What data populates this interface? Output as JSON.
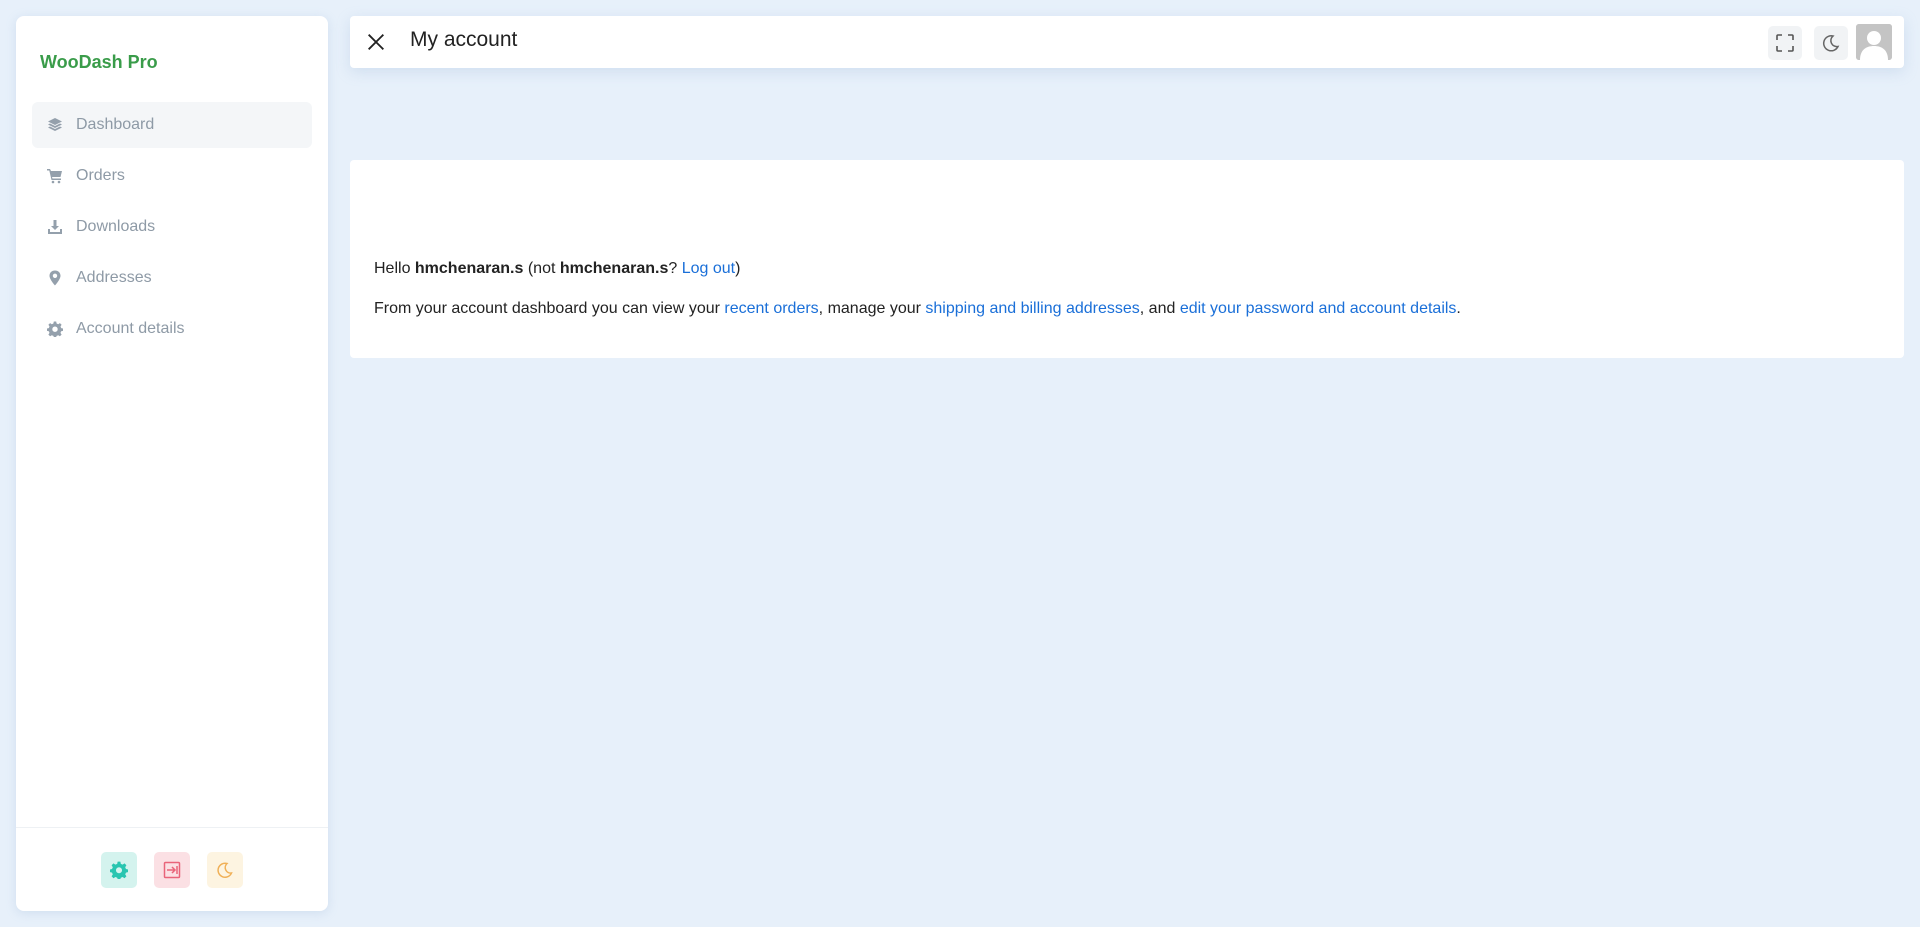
{
  "brand": "WooDash Pro",
  "sidebar": {
    "items": [
      {
        "label": "Dashboard",
        "icon": "layers-icon",
        "active": true
      },
      {
        "label": "Orders",
        "icon": "cart-icon"
      },
      {
        "label": "Downloads",
        "icon": "download-icon"
      },
      {
        "label": "Addresses",
        "icon": "map-pin-icon"
      },
      {
        "label": "Account details",
        "icon": "gear-icon"
      }
    ],
    "footer": [
      {
        "icon": "gear-icon",
        "color": "#29c5b0"
      },
      {
        "icon": "logout-icon",
        "color": "#e9647a"
      },
      {
        "icon": "moon-icon",
        "color": "#f0b057"
      }
    ]
  },
  "header": {
    "title": "My account"
  },
  "greeting": {
    "hello": "Hello ",
    "username": "hmchenaran.s",
    "not_open": " (not ",
    "username2": "hmchenaran.s",
    "q": "? ",
    "logout": "Log out",
    "close": ")"
  },
  "description": {
    "t1": "From your account dashboard you can view your ",
    "l1": "recent orders",
    "t2": ", manage your ",
    "l2": "shipping and billing addresses",
    "t3": ", and ",
    "l3": "edit your password and account details",
    "t4": "."
  },
  "colors": {
    "brand": "#3a9c4a",
    "link": "#1a6fd8",
    "background": "#e7f0fa"
  }
}
